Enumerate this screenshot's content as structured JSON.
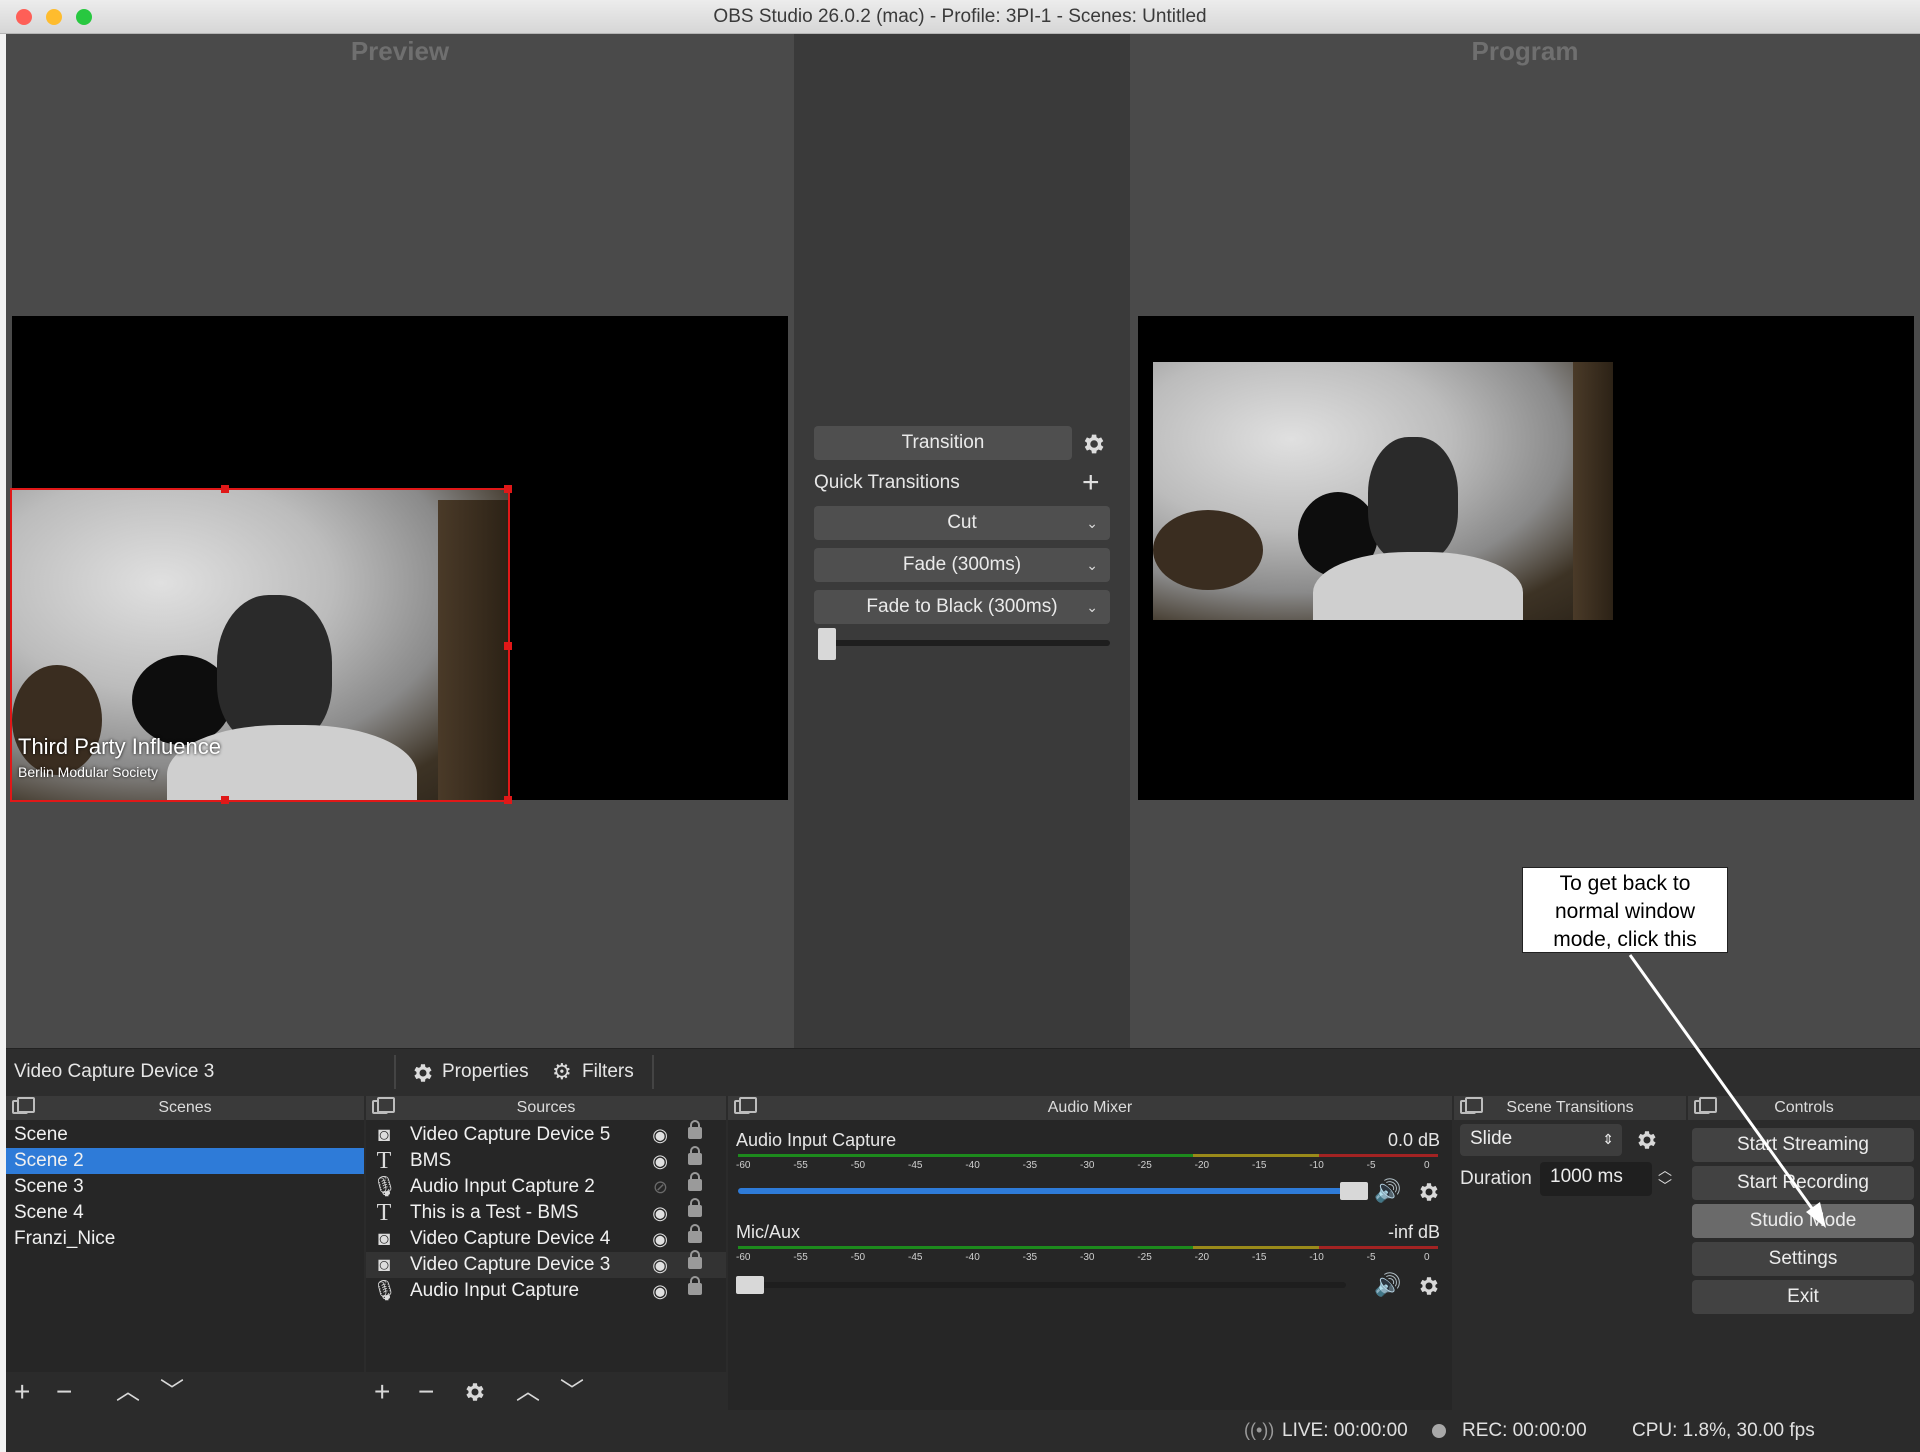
{
  "window": {
    "title": "OBS Studio 26.0.2 (mac) - Profile: 3PI-1 - Scenes: Untitled"
  },
  "preview": {
    "label": "Preview",
    "overlay_title": "Third Party Influence",
    "overlay_subtitle": "Berlin Modular Society"
  },
  "program": {
    "label": "Program"
  },
  "transition_panel": {
    "transition_button": "Transition",
    "quick_transitions_label": "Quick Transitions",
    "quick_items": [
      "Cut",
      "Fade (300ms)",
      "Fade to Black (300ms)"
    ],
    "tbar_position": 0
  },
  "context_bar": {
    "selected_source": "Video Capture Device 3",
    "properties_label": "Properties",
    "filters_label": "Filters"
  },
  "docks": {
    "scenes": "Scenes",
    "sources": "Sources",
    "audio_mixer": "Audio Mixer",
    "scene_transitions": "Scene Transitions",
    "controls": "Controls"
  },
  "scenes": {
    "items": [
      "Scene",
      "Scene 2",
      "Scene 3",
      "Scene 4",
      "Franzi_Nice"
    ],
    "selected": "Scene 2"
  },
  "sources": {
    "items": [
      {
        "name": "Video Capture Device 5",
        "icon": "camera-icon",
        "visible": true
      },
      {
        "name": "BMS",
        "icon": "text-icon",
        "visible": true
      },
      {
        "name": "Audio Input Capture 2",
        "icon": "microphone-icon",
        "visible": false
      },
      {
        "name": "This is a Test - BMS",
        "icon": "text-icon",
        "visible": true
      },
      {
        "name": "Video Capture Device 4",
        "icon": "camera-icon",
        "visible": true
      },
      {
        "name": "Video Capture Device 3",
        "icon": "camera-icon",
        "visible": true
      },
      {
        "name": "Audio Input Capture",
        "icon": "microphone-icon",
        "visible": true
      }
    ]
  },
  "audio_mixer": {
    "channels": [
      {
        "name": "Audio Input Capture",
        "level": "0.0 dB",
        "volume": 1.0
      },
      {
        "name": "Mic/Aux",
        "level": "-inf dB",
        "volume": 0.0
      }
    ],
    "scale": [
      "-60",
      "-55",
      "-50",
      "-45",
      "-40",
      "-35",
      "-30",
      "-25",
      "-20",
      "-15",
      "-10",
      "-5",
      "0"
    ]
  },
  "scene_transitions": {
    "transition": "Slide",
    "duration_label": "Duration",
    "duration_value": "1000 ms"
  },
  "controls": {
    "start_streaming": "Start Streaming",
    "start_recording": "Start Recording",
    "studio_mode": "Studio Mode",
    "settings": "Settings",
    "exit": "Exit"
  },
  "status": {
    "live": "LIVE: 00:00:00",
    "rec": "REC: 00:00:00",
    "cpu": "CPU: 1.8%, 30.00 fps"
  },
  "annotation": {
    "callout_text": [
      "To get back to",
      "normal window",
      "mode, click this"
    ]
  }
}
